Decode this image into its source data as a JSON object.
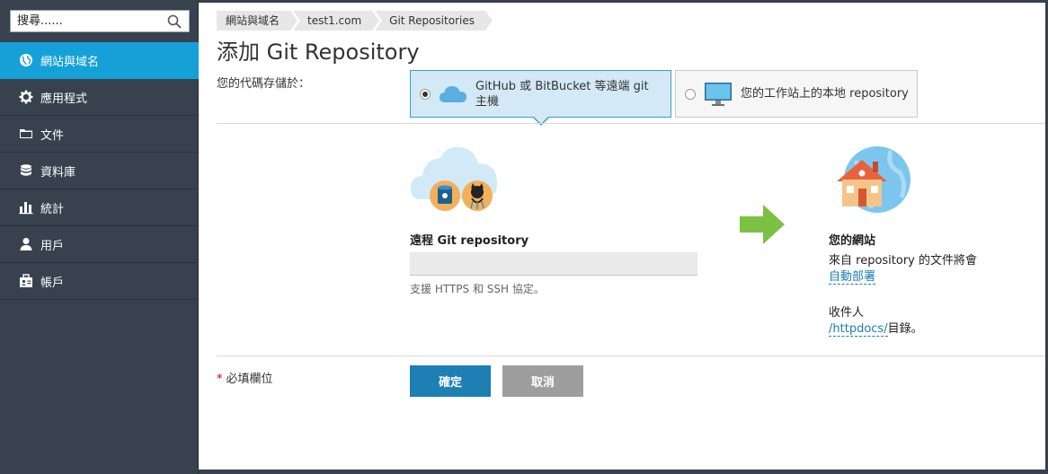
{
  "sidebar": {
    "search": {
      "placeholder": "搜尋......"
    },
    "items": [
      {
        "label": "網站與域名",
        "icon": "globe-icon",
        "active": true
      },
      {
        "label": "應用程式",
        "icon": "gear-icon",
        "active": false
      },
      {
        "label": "文件",
        "icon": "folder-icon",
        "active": false
      },
      {
        "label": "資料庫",
        "icon": "database-icon",
        "active": false
      },
      {
        "label": "統計",
        "icon": "bar-chart-icon",
        "active": false
      },
      {
        "label": "用戶",
        "icon": "user-icon",
        "active": false
      },
      {
        "label": "帳戶",
        "icon": "account-icon",
        "active": false
      }
    ]
  },
  "breadcrumb": [
    "網站與域名",
    "test1.com",
    "Git Repositories"
  ],
  "page": {
    "title": "添加 Git Repository",
    "store_label": "您的代碼存儲於：",
    "options": [
      {
        "label": "GitHub 或 BitBucket 等遠端 git 主機",
        "icon": "cloud-icon",
        "selected": true
      },
      {
        "label": "您的工作站上的本地 repository",
        "icon": "monitor-icon",
        "selected": false
      }
    ],
    "remote": {
      "label": "遠程 Git repository",
      "url_value": "",
      "hint": "支援 HTTPS 和 SSH 協定。"
    },
    "site": {
      "title": "您的網站",
      "desc": "來自 repository 的文件將會",
      "deploy_link": "自動部署",
      "to_label": "收件人",
      "dir_link": "/httpdocs/",
      "dir_suffix": "目錄。"
    },
    "required_label": "必填欄位",
    "required_star": "*",
    "ok_label": "確定",
    "cancel_label": "取消"
  },
  "colors": {
    "sidebar_bg": "#37424e",
    "active_item": "#16a0d8",
    "primary_button": "#1d7fb3",
    "cancel_button": "#9e9e9e",
    "link": "#1a7bbd",
    "arrow": "#7cc242"
  }
}
